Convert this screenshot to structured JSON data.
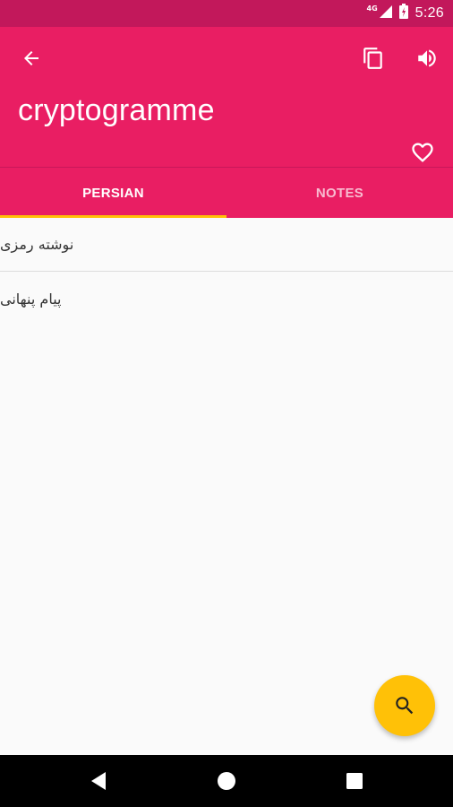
{
  "status_bar": {
    "network": "4G",
    "time": "5:26"
  },
  "app_bar": {
    "title": "cryptogramme",
    "icons": {
      "back": "arrow-back-icon",
      "copy": "copy-icon",
      "volume": "volume-icon",
      "favorite": "heart-outline-icon"
    }
  },
  "tabs": [
    {
      "label": "PERSIAN",
      "active": true
    },
    {
      "label": "NOTES",
      "active": false
    }
  ],
  "meanings": [
    "نوشته رمزی",
    "پیام پنهانی"
  ],
  "fab": {
    "icon": "search-icon"
  },
  "colors": {
    "primary": "#e91e63",
    "primary_dark": "#c2185b",
    "accent": "#ffc107",
    "background": "#fafafa"
  }
}
